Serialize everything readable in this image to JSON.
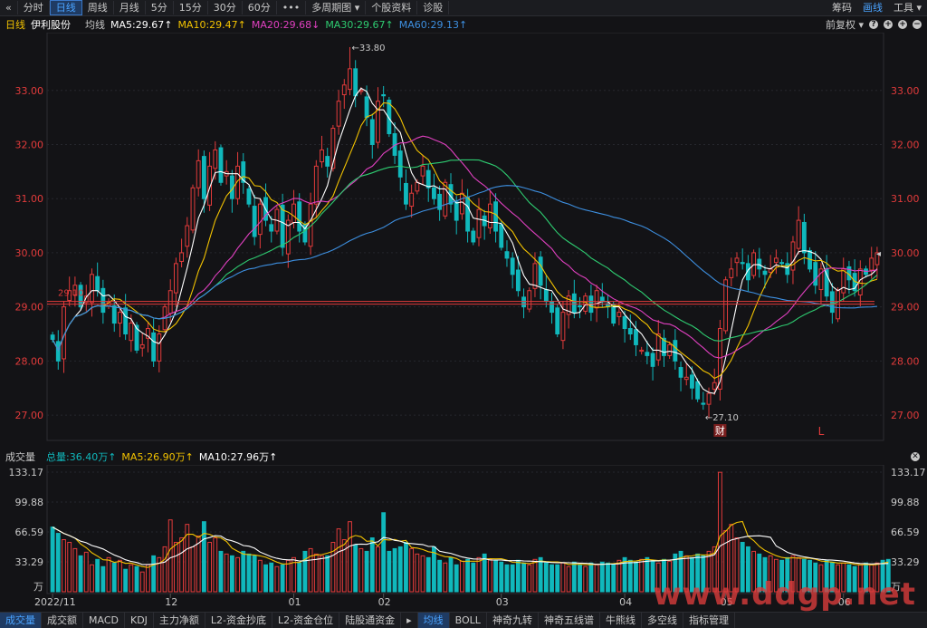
{
  "toolbar": {
    "back": "«",
    "tabs": [
      "分时",
      "日线",
      "周线",
      "月线",
      "5分",
      "15分",
      "30分",
      "60分",
      "•••",
      "多周期图 ▾",
      "个股资料",
      "诊股"
    ],
    "active_tab": 1,
    "right": [
      "筹码",
      "画线",
      "工具 ▾"
    ]
  },
  "legend": {
    "period": "日线",
    "stock": "伊利股份",
    "ma_label": "均线",
    "ma": [
      {
        "text": "MA5:29.67↑",
        "color": "#ffffff"
      },
      {
        "text": "MA10:29.47↑",
        "color": "#f2c200"
      },
      {
        "text": "MA20:29.68↓",
        "color": "#e040c0"
      },
      {
        "text": "MA30:29.67↑",
        "color": "#2ecc71"
      },
      {
        "text": "MA60:29.13↑",
        "color": "#3d8fe0"
      }
    ],
    "fuquan": "前复权 ▾",
    "icons": [
      "?",
      "+",
      "+",
      "−"
    ]
  },
  "vol_legend": {
    "title": "成交量",
    "total": "总量:36.40万↑",
    "ma5": "MA5:26.90万↑",
    "ma10": "MA10:27.96万↑",
    "close": "✕"
  },
  "bottom": {
    "tabs": [
      "成交量",
      "成交额",
      "MACD",
      "KDJ",
      "主力净额",
      "L2-资金抄底",
      "L2-资金仓位",
      "陆股通资金",
      "▸",
      "均线",
      "BOLL",
      "神奇九转",
      "神奇五线谱",
      "牛熊线",
      "多空线",
      "指标管理"
    ],
    "active": [
      0,
      9
    ]
  },
  "watermark": "www.ddgp.net",
  "colors": {
    "up": "#e23b3b",
    "down": "#10b8bc",
    "ma5": "#ffffff",
    "ma10": "#f2c200",
    "ma20": "#e040c0",
    "ma30": "#2ecc71",
    "ma60": "#3d8fe0",
    "ref": "#e23b3b"
  },
  "chart_data": [
    {
      "type": "candlestick",
      "price_ticks": [
        "33.00",
        "32.00",
        "31.00",
        "30.00",
        "29.00",
        "28.00",
        "27.00"
      ],
      "ylim": [
        26.7,
        33.9
      ],
      "annotations": {
        "high": "33.80",
        "low": "27.10",
        "left_level": "29.10",
        "marker_cai": "财",
        "marker_l": "L"
      },
      "ref_lines": [
        29.1,
        29.05
      ],
      "x_labels": [
        {
          "i": 0,
          "t": "2022/11"
        },
        {
          "i": 21,
          "t": "12"
        },
        {
          "i": 43,
          "t": "01"
        },
        {
          "i": 59,
          "t": "02"
        },
        {
          "i": 80,
          "t": "03"
        },
        {
          "i": 102,
          "t": "04"
        },
        {
          "i": 120,
          "t": "05"
        },
        {
          "i": 141,
          "t": "06"
        }
      ],
      "markers": [
        {
          "i": 119,
          "t": "财"
        },
        {
          "i": 137,
          "t": "L"
        }
      ],
      "high_index": 53,
      "low_index": 116,
      "closes": [
        28.4,
        28.0,
        29.0,
        29.3,
        29.4,
        29.0,
        29.2,
        29.6,
        29.3,
        28.9,
        29.1,
        28.7,
        28.9,
        28.5,
        28.7,
        28.2,
        28.3,
        28.6,
        28.0,
        28.5,
        29.0,
        29.3,
        29.8,
        30.0,
        30.5,
        31.2,
        31.7,
        31.0,
        31.6,
        31.9,
        31.3,
        31.5,
        31.0,
        31.6,
        31.3,
        30.9,
        30.3,
        30.9,
        30.6,
        30.4,
        30.8,
        30.1,
        30.6,
        30.9,
        30.4,
        30.2,
        30.9,
        31.6,
        31.9,
        31.6,
        32.3,
        32.8,
        33.1,
        33.4,
        32.9,
        33.0,
        32.5,
        32.0,
        32.8,
        32.9,
        32.2,
        31.8,
        31.4,
        30.9,
        31.1,
        31.3,
        31.6,
        31.2,
        31.0,
        30.8,
        31.3,
        30.9,
        30.6,
        31.1,
        30.4,
        30.2,
        30.8,
        30.5,
        30.9,
        30.4,
        30.1,
        29.9,
        29.6,
        29.3,
        29.0,
        29.3,
        29.8,
        29.4,
        29.1,
        28.9,
        28.5,
        28.9,
        29.2,
        28.9,
        29.0,
        29.2,
        28.9,
        29.3,
        29.1,
        29.0,
        28.7,
        28.9,
        28.6,
        28.5,
        28.3,
        28.2,
        28.1,
        27.9,
        28.5,
        28.1,
        28.3,
        28.0,
        27.7,
        27.7,
        27.5,
        27.3,
        27.2,
        27.4,
        27.6,
        28.6,
        29.5,
        29.7,
        29.9,
        29.8,
        29.5,
        30.0,
        29.7,
        29.6,
        29.7,
        29.9,
        29.8,
        29.6,
        30.2,
        30.6,
        30.0,
        29.7,
        29.4,
        29.7,
        29.2,
        28.9,
        29.3,
        29.7,
        29.5,
        29.3,
        29.7,
        29.6,
        29.9,
        30.0
      ]
    },
    {
      "type": "bar",
      "title": "成交量",
      "y_ticks": [
        "133.17",
        "99.88",
        "66.59",
        "33.29",
        "万"
      ],
      "ylim": [
        0,
        133.17
      ],
      "values": [
        72,
        65,
        58,
        55,
        48,
        40,
        44,
        30,
        36,
        28,
        38,
        32,
        35,
        25,
        30,
        28,
        22,
        30,
        40,
        38,
        50,
        80,
        55,
        60,
        75,
        50,
        62,
        78,
        55,
        60,
        45,
        42,
        40,
        38,
        45,
        42,
        40,
        35,
        30,
        32,
        28,
        30,
        35,
        38,
        32,
        45,
        48,
        42,
        40,
        40,
        55,
        70,
        58,
        78,
        52,
        48,
        45,
        60,
        50,
        88,
        45,
        48,
        50,
        55,
        48,
        42,
        40,
        38,
        50,
        35,
        32,
        38,
        30,
        34,
        36,
        32,
        38,
        42,
        36,
        35,
        33,
        30,
        30,
        35,
        32,
        30,
        36,
        38,
        32,
        30,
        30,
        32,
        28,
        33,
        30,
        28,
        32,
        30,
        33,
        32,
        30,
        35,
        38,
        35,
        33,
        36,
        38,
        35,
        32,
        36,
        34,
        42,
        45,
        40,
        38,
        42,
        40,
        45,
        50,
        133,
        68,
        75,
        60,
        55,
        50,
        45,
        42,
        38,
        40,
        36,
        35,
        38,
        40,
        38,
        36,
        35,
        32,
        30,
        35,
        33,
        30,
        32,
        30,
        28,
        30,
        32,
        30,
        32,
        35,
        36
      ]
    }
  ]
}
